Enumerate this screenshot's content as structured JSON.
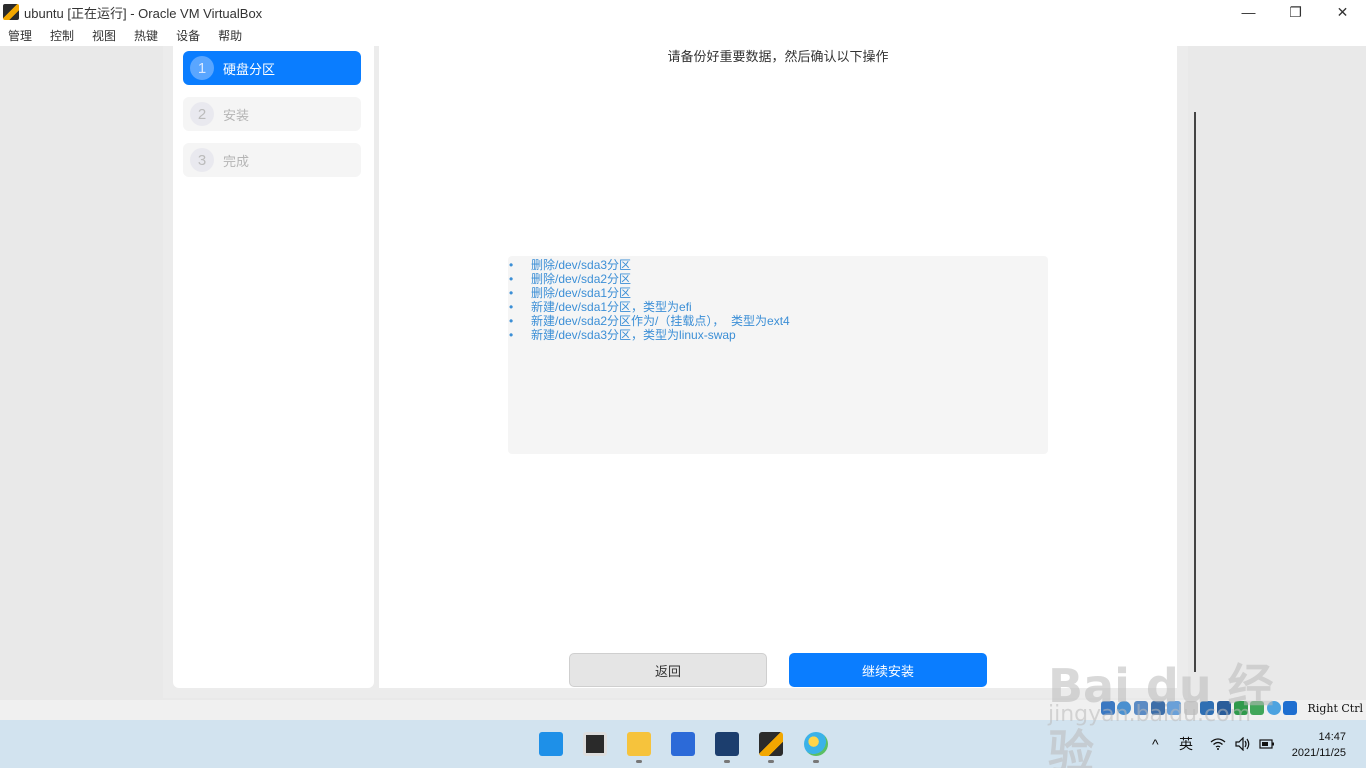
{
  "window": {
    "title": "ubuntu [正在运行] - Oracle VM VirtualBox",
    "minimize": "—",
    "maximize": "❐",
    "close": "✕"
  },
  "menu": [
    "管理",
    "控制",
    "视图",
    "热键",
    "设备",
    "帮助"
  ],
  "steps": [
    {
      "num": "1",
      "label": "硬盘分区",
      "active": true
    },
    {
      "num": "2",
      "label": "安装",
      "active": false
    },
    {
      "num": "3",
      "label": "完成",
      "active": false
    }
  ],
  "main": {
    "headline": "请备份好重要数据，然后确认以下操作",
    "bullet": "•",
    "operations": [
      "删除/dev/sda3分区",
      "删除/dev/sda2分区",
      "删除/dev/sda1分区",
      "新建/dev/sda1分区，类型为efi",
      "新建/dev/sda2分区作为/（挂载点），  类型为ext4",
      "新建/dev/sda3分区，类型为linux-swap"
    ],
    "back_button": "返回",
    "continue_button": "继续安装"
  },
  "statusbar": {
    "host_key": "Right Ctrl",
    "icons": [
      "hard-disk-icon",
      "optical-drive-icon",
      "audio-icon",
      "network-icon",
      "usb-icon",
      "shared-folders-icon",
      "display-icon",
      "video-capture-icon",
      "recording-icon",
      "cpu-icon",
      "mouse-integration-icon",
      "keyboard-icon"
    ]
  },
  "taskbar": {
    "apps": [
      "start-icon",
      "task-view-icon",
      "file-explorer-icon",
      "store-icon",
      "virtualbox-icon",
      "virtualbox-vm-icon",
      "paint-icon"
    ],
    "tray_chevron": "^",
    "ime": "英",
    "time": "14:47",
    "date": "2021/11/25"
  },
  "watermark": {
    "main": "Bai du 经验",
    "sub": "jingyan.baidu.com"
  },
  "colors": {
    "accent": "#0a7dff",
    "link_blue": "#3c8fd6",
    "taskbar": "#d2e3ef"
  }
}
